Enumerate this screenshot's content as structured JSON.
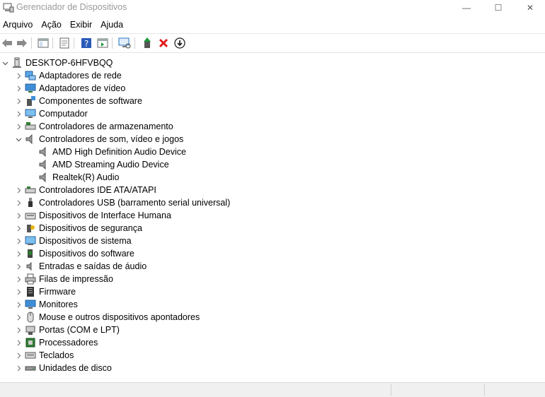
{
  "window": {
    "title": "Gerenciador de Dispositivos",
    "minimize_glyph": "—",
    "maximize_glyph": "☐",
    "close_glyph": "✕"
  },
  "menu": [
    "Arquivo",
    "Ação",
    "Exibir",
    "Ajuda"
  ],
  "toolbar": {
    "icons": [
      "back-icon",
      "forward-icon",
      "show-hide-console-tree-icon",
      "properties-icon",
      "help-icon",
      "action-pane-icon",
      "scan-hardware-icon",
      "update-driver-icon",
      "uninstall-icon",
      "disable-device-icon"
    ]
  },
  "tree": {
    "root": "DESKTOP-6HFVBQQ",
    "categories": [
      {
        "label": "Adaptadores de rede",
        "icon": "network-adapter-icon",
        "expanded": false
      },
      {
        "label": "Adaptadores de vídeo",
        "icon": "display-adapter-icon",
        "expanded": false
      },
      {
        "label": "Componentes de software",
        "icon": "software-component-icon",
        "expanded": false
      },
      {
        "label": "Computador",
        "icon": "computer-icon",
        "expanded": false
      },
      {
        "label": "Controladores de armazenamento",
        "icon": "storage-controller-icon",
        "expanded": false
      },
      {
        "label": "Controladores de som, vídeo e jogos",
        "icon": "speaker-icon",
        "expanded": true,
        "children": [
          "AMD High Definition Audio Device",
          "AMD Streaming Audio Device",
          "Realtek(R) Audio"
        ]
      },
      {
        "label": "Controladores IDE ATA/ATAPI",
        "icon": "ide-controller-icon",
        "expanded": false
      },
      {
        "label": "Controladores USB (barramento serial universal)",
        "icon": "usb-icon",
        "expanded": false
      },
      {
        "label": "Dispositivos de Interface Humana",
        "icon": "hid-icon",
        "expanded": false
      },
      {
        "label": "Dispositivos de segurança",
        "icon": "security-device-icon",
        "expanded": false
      },
      {
        "label": "Dispositivos de sistema",
        "icon": "system-device-icon",
        "expanded": false
      },
      {
        "label": "Dispositivos do software",
        "icon": "software-device-icon",
        "expanded": false
      },
      {
        "label": "Entradas e saídas de áudio",
        "icon": "audio-io-icon",
        "expanded": false
      },
      {
        "label": "Filas de impressão",
        "icon": "printer-icon",
        "expanded": false
      },
      {
        "label": "Firmware",
        "icon": "firmware-icon",
        "expanded": false
      },
      {
        "label": "Monitores",
        "icon": "monitor-icon",
        "expanded": false
      },
      {
        "label": "Mouse e outros dispositivos apontadores",
        "icon": "mouse-icon",
        "expanded": false
      },
      {
        "label": "Portas (COM e LPT)",
        "icon": "port-icon",
        "expanded": false
      },
      {
        "label": "Processadores",
        "icon": "processor-icon",
        "expanded": false
      },
      {
        "label": "Teclados",
        "icon": "keyboard-icon",
        "expanded": false
      },
      {
        "label": "Unidades de disco",
        "icon": "disk-drive-icon",
        "expanded": false
      }
    ]
  },
  "colors": {
    "accent_blue": "#1e73d2",
    "uninstall_red": "#e01b1b",
    "update_green": "#1a9a3a"
  }
}
